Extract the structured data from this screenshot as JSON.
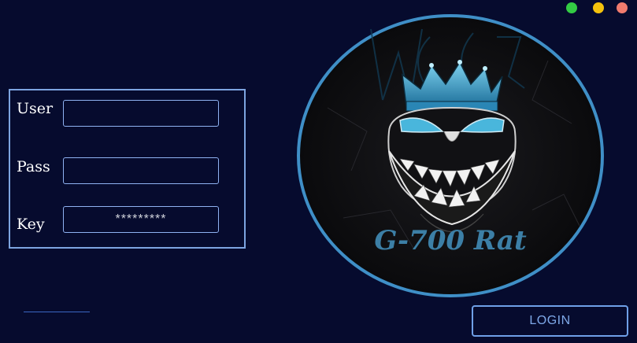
{
  "window": {
    "controls": [
      "green-button",
      "yellow-button",
      "red-button"
    ]
  },
  "form": {
    "user_label": "User",
    "pass_label": "Pass",
    "key_label": "Key",
    "user_value": "",
    "pass_value": "",
    "key_placeholder": "*********"
  },
  "logo": {
    "text": "G-700 Rat",
    "icon": "crowned-grinning-skull"
  },
  "actions": {
    "login_label": "LOGIN"
  },
  "colors": {
    "background": "#060b2e",
    "accent": "#6fa0e8",
    "logo_ring": "#3f8fc7",
    "logo_text": "#3c7fa6"
  }
}
